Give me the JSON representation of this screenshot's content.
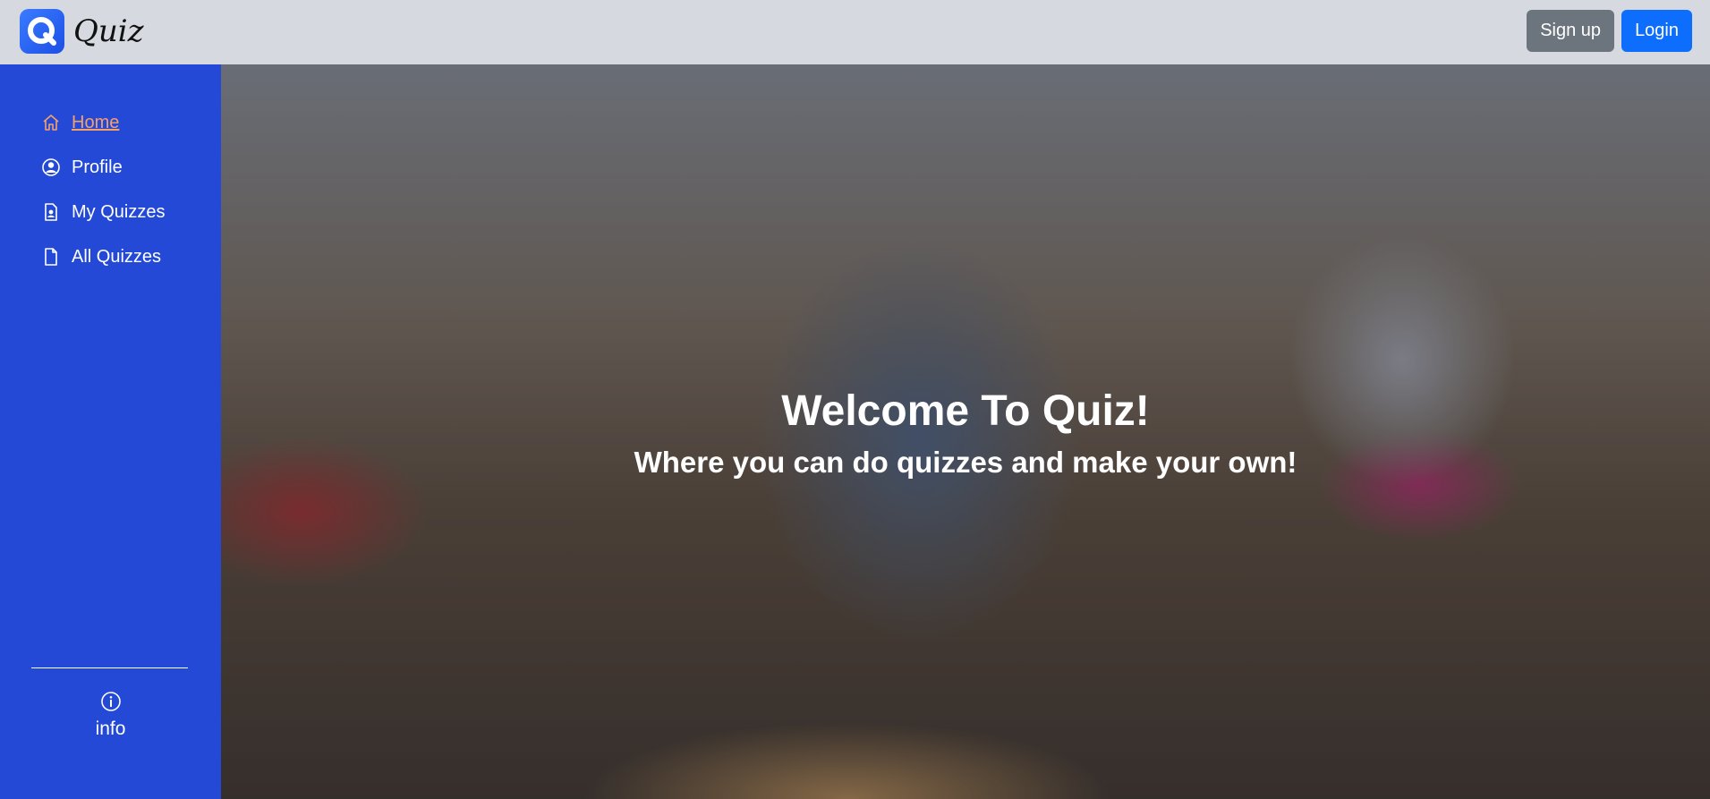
{
  "header": {
    "brand_name": "Quiz",
    "logo_letter": "Q",
    "signup_label": "Sign up",
    "login_label": "Login"
  },
  "sidebar": {
    "items": [
      {
        "label": "Home",
        "icon": "house-icon",
        "active": true
      },
      {
        "label": "Profile",
        "icon": "person-circle-icon",
        "active": false
      },
      {
        "label": "My Quizzes",
        "icon": "file-person-icon",
        "active": false
      },
      {
        "label": "All Quizzes",
        "icon": "file-icon",
        "active": false
      }
    ],
    "info_label": "info",
    "info_icon": "info-circle-icon"
  },
  "hero": {
    "title": "Welcome To Quiz!",
    "subtitle": "Where you can do quizzes and make your own!"
  },
  "colors": {
    "sidebar_bg": "#2449d6",
    "topbar_bg": "#d6d9e0",
    "active_link": "#f5a06a",
    "signup_bg": "#6c757d",
    "login_bg": "#0d6efd"
  }
}
